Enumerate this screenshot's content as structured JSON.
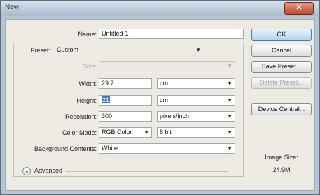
{
  "window": {
    "title": "New",
    "close_glyph": "✕"
  },
  "form": {
    "name": {
      "label": "Name:",
      "value": "Untitled-1"
    },
    "preset": {
      "label": "Preset:",
      "value": "Custom"
    },
    "size": {
      "label": "Size:",
      "value": ""
    },
    "width": {
      "label": "Width:",
      "value": "29.7",
      "unit": "cm"
    },
    "height": {
      "label": "Height:",
      "value": "21",
      "unit": "cm"
    },
    "resolution": {
      "label": "Resolution:",
      "value": "300",
      "unit": "pixels/inch"
    },
    "color_mode": {
      "label": "Color Mode:",
      "value": "RGB Color",
      "bits": "8 bit"
    },
    "background": {
      "label": "Background Contents:",
      "value": "White"
    },
    "advanced": {
      "label": "Advanced",
      "toggle_glyph": "»"
    }
  },
  "buttons": {
    "ok": "OK",
    "cancel": "Cancel",
    "save_preset": "Save Preset...",
    "delete_preset": "Delete Preset...",
    "device_central": "Device Central..."
  },
  "image_size": {
    "label": "Image Size:",
    "value": "24.9M"
  },
  "icons": {
    "dropdown": "chevron-down-icon",
    "advanced": "double-chevron-icon"
  }
}
